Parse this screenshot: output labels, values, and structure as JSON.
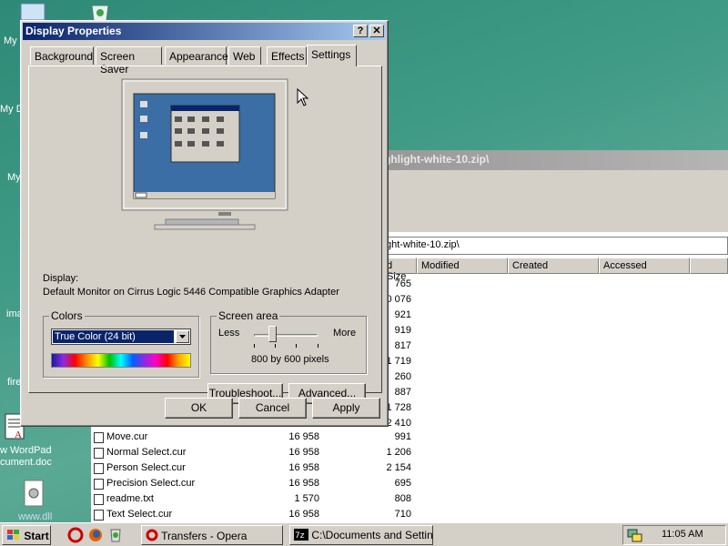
{
  "desktop": {
    "labels": [
      "My",
      "My D",
      "My",
      "ima",
      "fire",
      "w WordPad",
      "cument.doc",
      "www.dll"
    ]
  },
  "bg_window": {
    "title": "ghlight-white-10.zip\\",
    "address": "ght-white-10.zip\\",
    "columns": [
      "d Size",
      "Modified",
      "Created",
      "Accessed"
    ],
    "packed_only": [
      "765",
      "0 076",
      "921",
      "919",
      "817",
      "1 719",
      "260",
      "887",
      "1 728",
      "2 410"
    ],
    "rows": [
      {
        "name": "Move.cur",
        "size": "16 958",
        "packed": "991"
      },
      {
        "name": "Normal Select.cur",
        "size": "16 958",
        "packed": "1 206"
      },
      {
        "name": "Person Select.cur",
        "size": "16 958",
        "packed": "2 154"
      },
      {
        "name": "Precision Select.cur",
        "size": "16 958",
        "packed": "695"
      },
      {
        "name": "readme.txt",
        "size": "1 570",
        "packed": "808"
      },
      {
        "name": "Text Select.cur",
        "size": "16 958",
        "packed": "710"
      }
    ]
  },
  "dialog": {
    "title": "Display Properties",
    "help_label": "?",
    "close_label": "✕",
    "tabs": [
      "Background",
      "Screen Saver",
      "Appearance",
      "Web",
      "Effects",
      "Settings"
    ],
    "display_label": "Display:",
    "display_value": "Default Monitor on Cirrus Logic 5446 Compatible Graphics Adapter",
    "colors_label": "Colors",
    "colors_value": "True Color (24 bit)",
    "screen_area_label": "Screen area",
    "less_label": "Less",
    "more_label": "More",
    "resolution_text": "800 by 600 pixels",
    "troubleshoot_label": "Troubleshoot...",
    "advanced_label": "Advanced...",
    "ok_label": "OK",
    "cancel_label": "Cancel",
    "apply_label": "Apply"
  },
  "taskbar": {
    "start_label": "Start",
    "tasks": [
      "Transfers - Opera",
      "C:\\Documents and Settin..."
    ],
    "clock": "11:05 AM"
  },
  "colors": {
    "title_active": "#0a246a",
    "title_gradient_end": "#a6caf0",
    "face": "#d4d0c8",
    "select_highlight": "#0a246a",
    "preview_desktop": "#3a6ea5"
  }
}
